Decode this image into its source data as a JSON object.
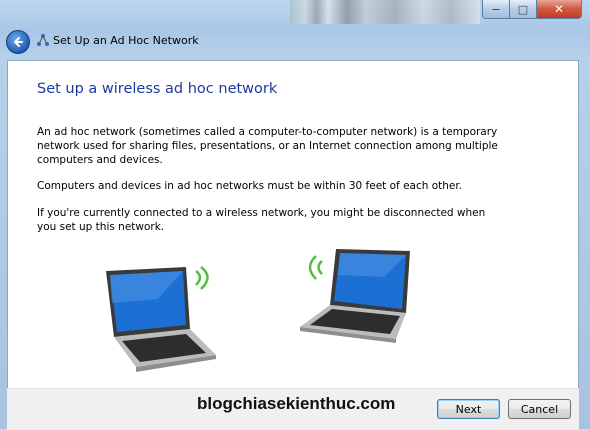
{
  "window": {
    "title": "Set Up an Ad Hoc Network",
    "controls": {
      "minimize": "−",
      "maximize": "□",
      "close": "✕"
    }
  },
  "page": {
    "heading": "Set up a wireless ad hoc network",
    "paragraphs": [
      "An ad hoc network (sometimes called a computer-to-computer network) is a temporary network used for sharing files, presentations, or an Internet connection among multiple computers and devices.",
      "Computers and devices in ad hoc networks must be within 30 feet of each other.",
      "If you're currently connected to a wireless network, you might be disconnected when you set up this network."
    ]
  },
  "footer": {
    "watermark": "blogchiasekienthuc.com",
    "next_label": "Next",
    "cancel_label": "Cancel"
  },
  "icons": {
    "back": "back-arrow-icon",
    "network": "network-icon",
    "laptops": [
      "laptop-wireless-icon",
      "laptop-wireless-icon"
    ]
  },
  "colors": {
    "heading": "#1e3a9e",
    "frame": "#a9c7e6",
    "close_button": "#c13a22"
  }
}
